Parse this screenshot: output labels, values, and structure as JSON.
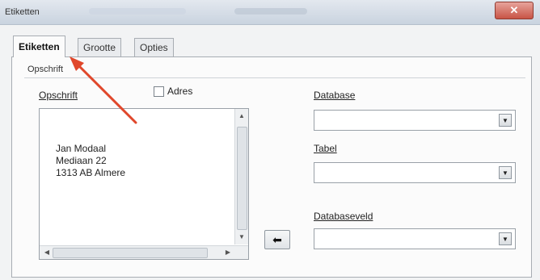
{
  "window": {
    "title": "Etiketten",
    "close_symbol": "✕"
  },
  "tabs": [
    {
      "label": "Etiketten",
      "active": true
    },
    {
      "label": "Grootte",
      "active": false
    },
    {
      "label": "Opties",
      "active": false
    }
  ],
  "group": {
    "title": "Opschrift"
  },
  "inscription": {
    "label": "Opschrift",
    "checkbox_label": "Adres",
    "checkbox_checked": false,
    "text_lines": [
      "Jan Modaal",
      "Mediaan 22",
      "1313 AB Almere"
    ]
  },
  "database": {
    "label": "Database",
    "value": ""
  },
  "table": {
    "label": "Tabel",
    "value": ""
  },
  "database_field": {
    "label": "Databaseveld",
    "value": ""
  },
  "insert_button": {
    "symbol": "⬅"
  },
  "annotation": {
    "color": "#e0472b"
  }
}
